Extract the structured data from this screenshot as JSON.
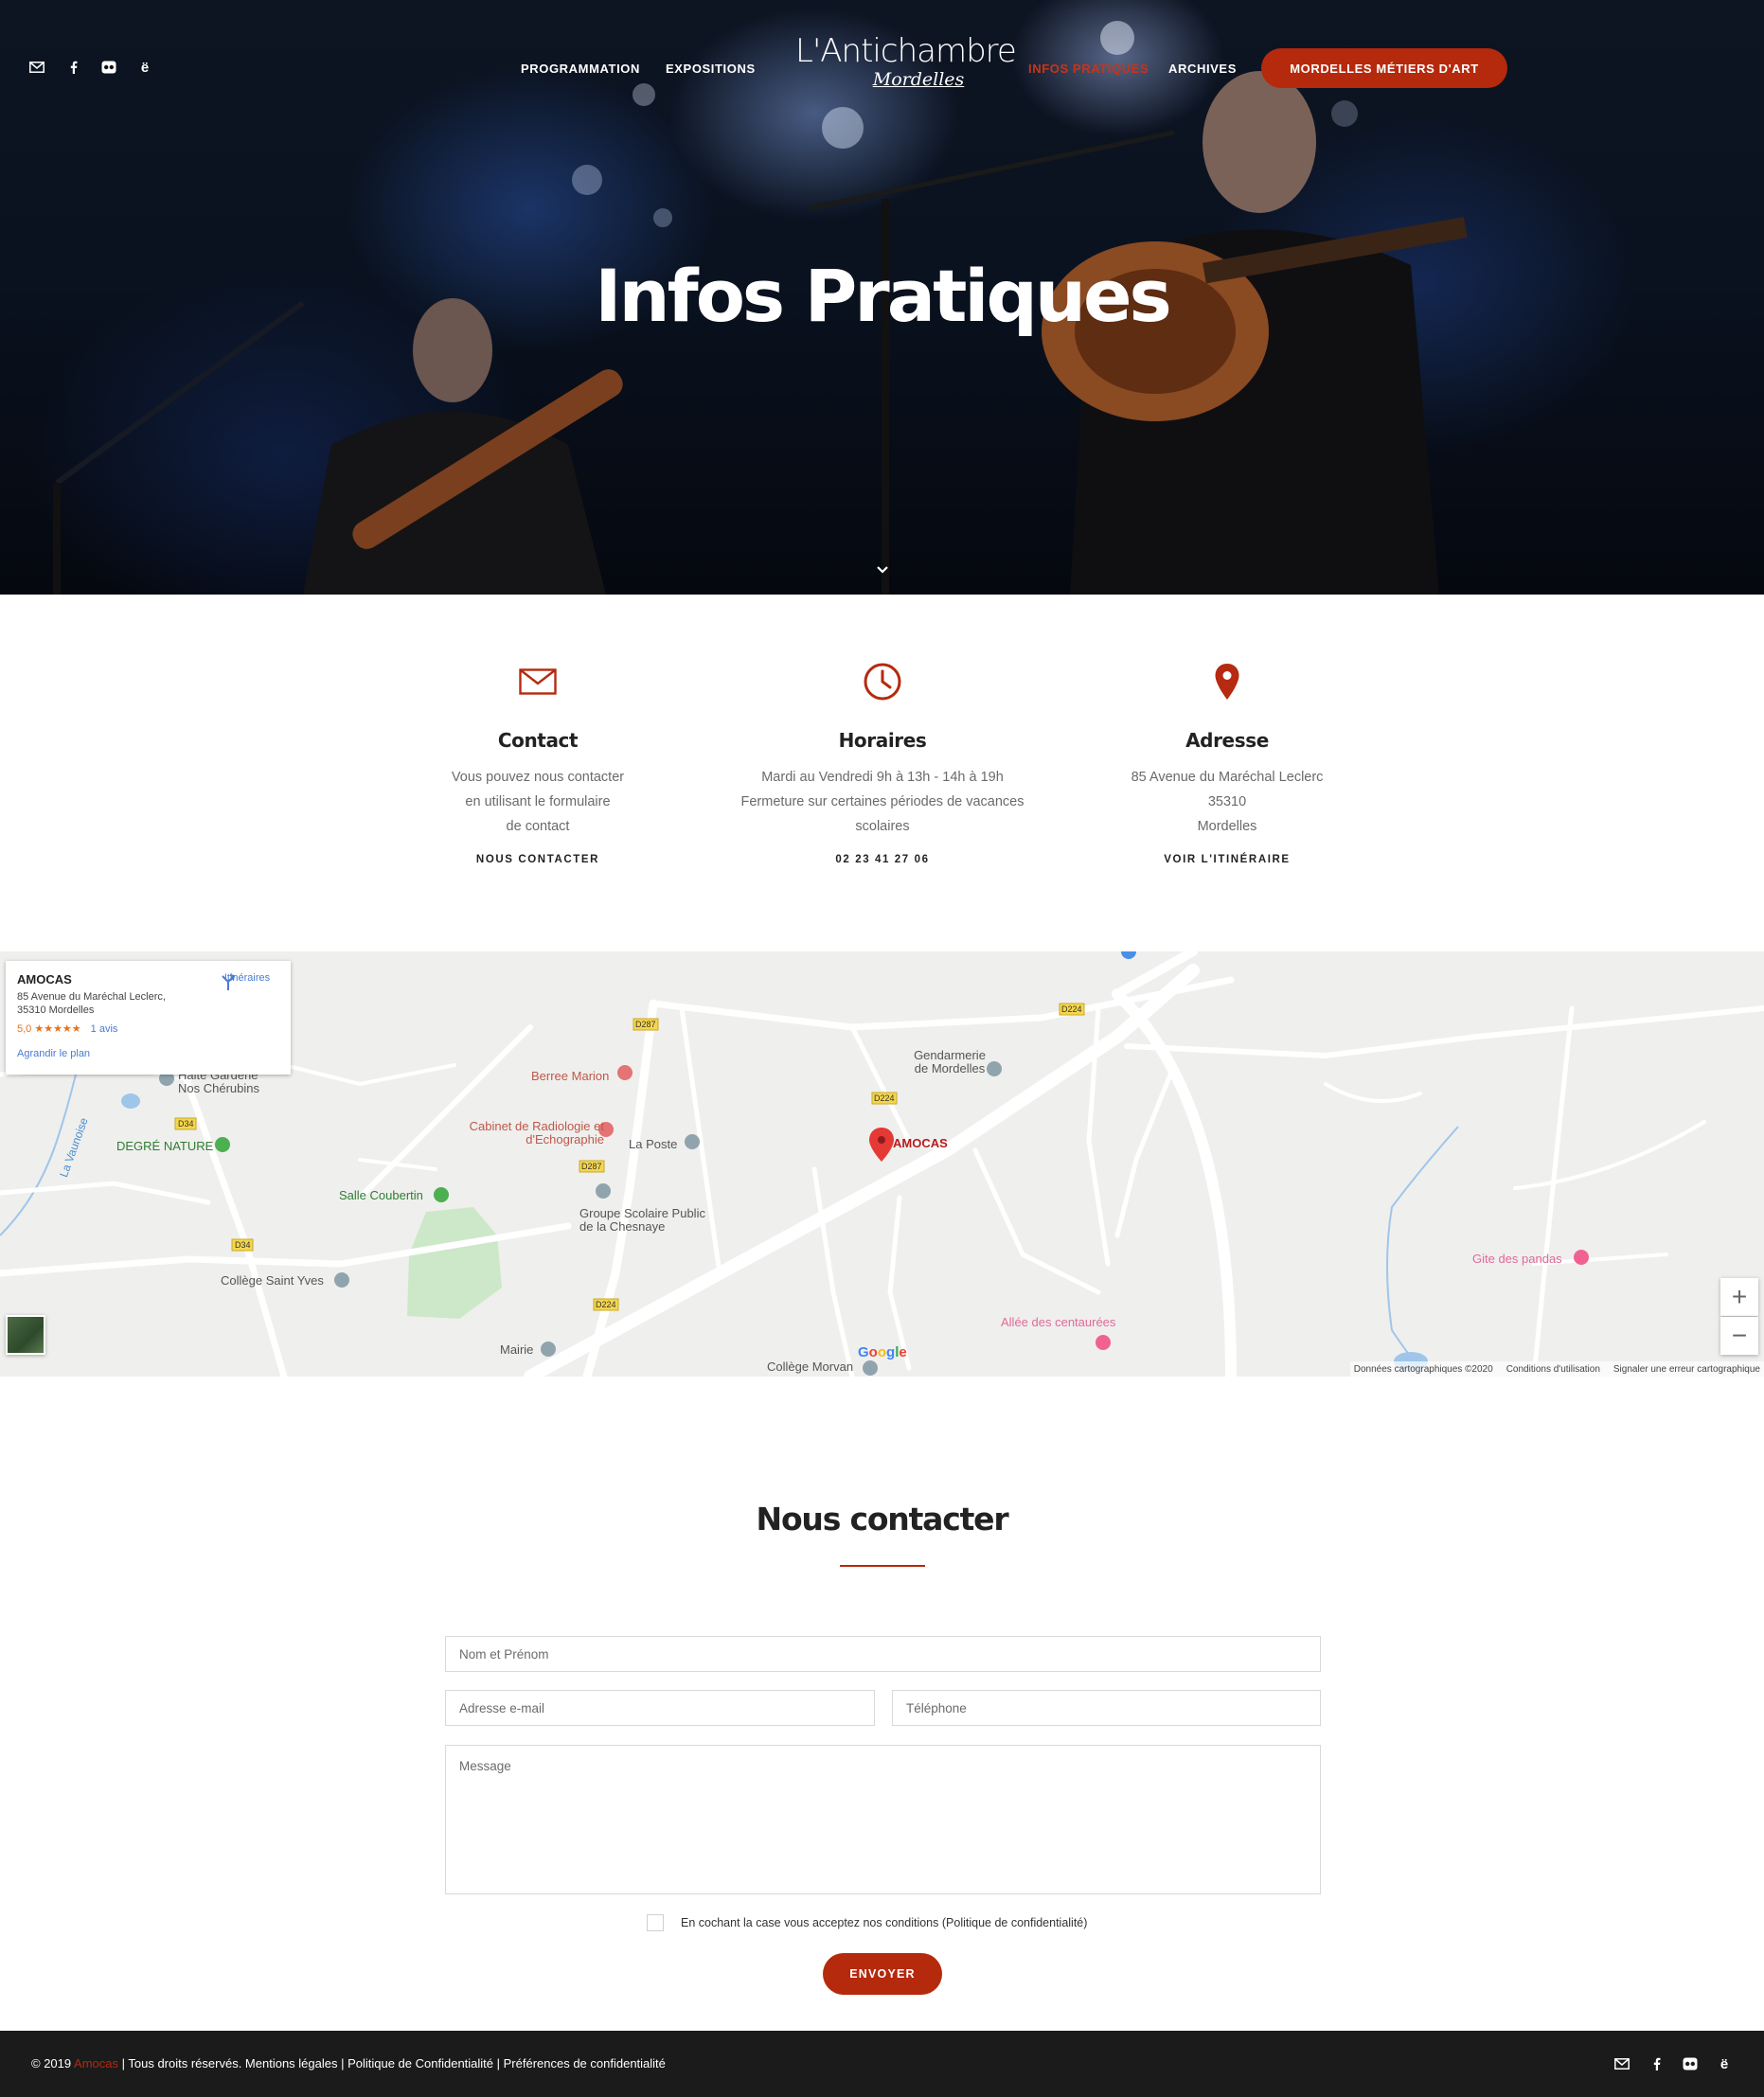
{
  "header": {
    "nav_left": [
      "PROGRAMMATION",
      "EXPOSITIONS"
    ],
    "nav_right": [
      "INFOS PRATIQUES",
      "ARCHIVES"
    ],
    "logo_line1": "L'Antichambre",
    "logo_line2": "Mordelles",
    "cta_label": "MORDELLES MÉTIERS D'ART",
    "active_item": "INFOS PRATIQUES",
    "social_icons": [
      "mail-icon",
      "facebook-icon",
      "flickr-icon",
      "e-icon"
    ]
  },
  "hero": {
    "title": "Infos Pratiques",
    "scroll_icon": "chevron-down-icon"
  },
  "info": [
    {
      "icon": "envelope-icon",
      "title": "Contact",
      "lines": [
        "Vous pouvez nous contacter",
        "en utilisant le formulaire",
        "de contact"
      ],
      "link": "NOUS CONTACTER"
    },
    {
      "icon": "clock-icon",
      "title": "Horaires",
      "lines": [
        "Mardi au Vendredi 9h à 13h - 14h à 19h",
        "Fermeture sur certaines périodes de vacances",
        "scolaires"
      ],
      "link": "02 23 41 27 06"
    },
    {
      "icon": "map-pin-icon",
      "title": "Adresse",
      "lines": [
        "85 Avenue du Maréchal Leclerc",
        "35310",
        "Mordelles"
      ],
      "link": "VOIR L'ITINÉRAIRE"
    }
  ],
  "map": {
    "card": {
      "name": "AMOCAS",
      "address": "85 Avenue du Maréchal Leclerc, 35310 Mordelles",
      "rating": "5,0 ★★★★★",
      "reviews": "1 avis",
      "enlarge": "Agrandir le plan",
      "directions": "Itinéraires"
    },
    "labels": {
      "amocas": "AMOCAS",
      "gendarmerie": "Gendarmerie de Mordelles",
      "berree": "Berree Marion",
      "radiologie": "Cabinet de Radiologie et d'Echographie",
      "poste": "La Poste",
      "halte": "Halte Garderie Nos Chérubins",
      "degre": "DEGRÉ NATURE",
      "coubertin": "Salle Coubertin",
      "groupe": "Groupe Scolaire Public de la Chesnaye",
      "college_sy": "Collège Saint Yves",
      "mairie": "Mairie",
      "college_m": "Collège Morvan",
      "gite": "Gite des pandas",
      "allee": "Allée des centaurées",
      "vaunoise": "La Vaunoise"
    },
    "roads": {
      "d287a": "D287",
      "d224a": "D224",
      "d224b": "D224",
      "d34a": "D34",
      "d34b": "D34",
      "d287b": "D287",
      "d224c": "D224"
    },
    "google": "Google",
    "attribution": [
      "Données cartographiques ©2020",
      "Conditions d'utilisation",
      "Signaler une erreur cartographique"
    ],
    "zoom_in": "+",
    "zoom_out": "−"
  },
  "contact_form": {
    "title": "Nous contacter",
    "name_placeholder": "Nom et Prénom",
    "email_placeholder": "Adresse e-mail",
    "phone_placeholder": "Téléphone",
    "message_placeholder": "Message",
    "consent": "En cochant la case vous acceptez nos conditions (Politique de confidentialité)",
    "submit": "ENVOYER"
  },
  "footer": {
    "copyright_prefix": "© 2019",
    "brand": "Amocas",
    "rest": "| Tous droits réservés. Mentions légales | Politique de Confidentialité | Préférences de confidentialité"
  },
  "colors": {
    "accent": "#b5290d",
    "footer_bg": "#1b1b1b",
    "text_muted": "#6a6a6a"
  }
}
